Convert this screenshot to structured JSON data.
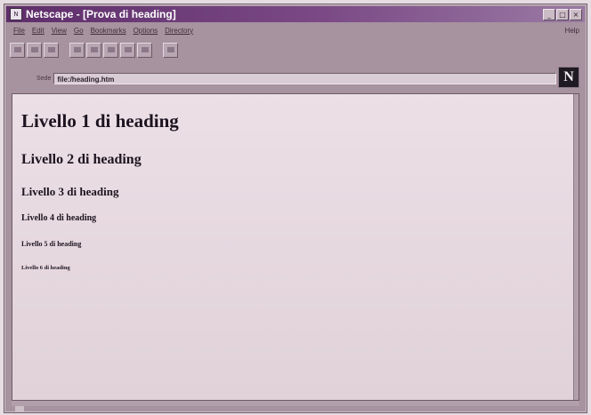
{
  "window": {
    "title": "Netscape - [Prova di heading]",
    "app_icon": "netscape-small-icon",
    "controls": [
      "_",
      "□",
      "×"
    ]
  },
  "menubar": {
    "items": [
      "File",
      "Edit",
      "View",
      "Go",
      "Bookmarks",
      "Options",
      "Directory"
    ],
    "right_item": "Help"
  },
  "toolbar": {
    "buttons": [
      "back-icon",
      "forward-icon",
      "home-icon",
      "reload-icon",
      "images-icon",
      "open-icon",
      "print-icon",
      "find-icon",
      "stop-icon"
    ]
  },
  "location": {
    "label": "Sede",
    "url": "file:/heading.htm"
  },
  "brand": {
    "letter": "N"
  },
  "page": {
    "h1": "Livello 1 di heading",
    "h2": "Livello 2 di heading",
    "h3": "Livello 3 di heading",
    "h4": "Livello 4 di heading",
    "h5": "Livello 5 di heading",
    "h6": "Livello 6 di heading"
  },
  "colors": {
    "titlebar": "#5e2e6a",
    "content_bg": "#e8d8e0",
    "chrome": "#a7929f"
  }
}
